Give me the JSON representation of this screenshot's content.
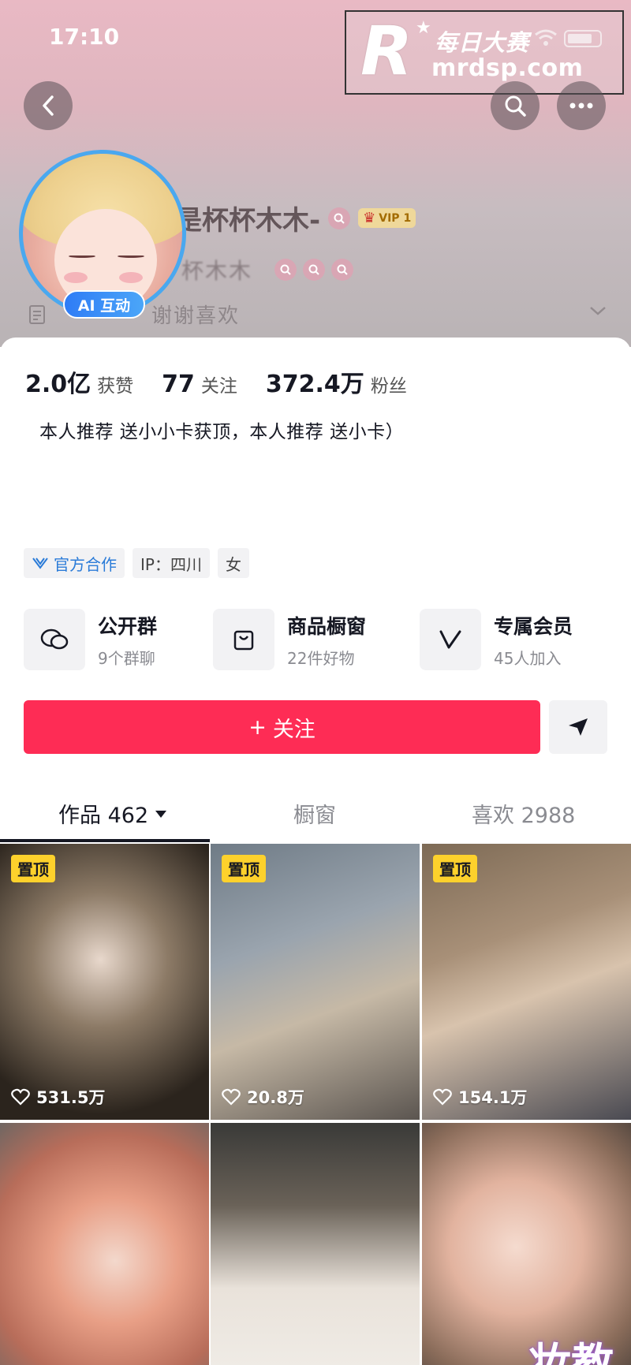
{
  "status_bar": {
    "time": "17:10"
  },
  "watermark": {
    "logo_letter": "R",
    "brand_cn": "每日大赛",
    "domain": "mrdsp.com"
  },
  "header": {
    "display_name": "是杯杯木木-",
    "vip_label": "VIP 1",
    "account_id": "杯木木",
    "signature": "谢谢喜欢"
  },
  "avatar": {
    "badge": "AI 互动"
  },
  "stats": [
    {
      "value": "2.0亿",
      "label": "获赞"
    },
    {
      "value": "77",
      "label": "关注"
    },
    {
      "value": "372.4万",
      "label": "粉丝"
    }
  ],
  "bio": "本人推荐 送小小卡获顶，本人推荐 送小卡）",
  "tags": [
    {
      "label": "官方合作",
      "icon": "official-cooperation-icon"
    },
    {
      "label": "IP：四川"
    },
    {
      "label": "女"
    }
  ],
  "features": [
    {
      "title": "公开群",
      "subtitle": "9个群聊",
      "icon": "group-chat-icon"
    },
    {
      "title": "商品橱窗",
      "subtitle": "22件好物",
      "icon": "shopping-bag-icon"
    },
    {
      "title": "专属会员",
      "subtitle": "45人加入",
      "icon": "vip-v-icon"
    }
  ],
  "actions": {
    "follow_label": "关注",
    "follow_prefix": "+"
  },
  "tabs": [
    {
      "label": "作品 462",
      "active": true
    },
    {
      "label": "橱窗",
      "active": false
    },
    {
      "label": "喜欢 2988",
      "active": false
    }
  ],
  "videos": [
    {
      "pinned": true,
      "pin_label": "置顶",
      "likes": "531.5万"
    },
    {
      "pinned": true,
      "pin_label": "置顶",
      "likes": "20.8万"
    },
    {
      "pinned": true,
      "pin_label": "置顶",
      "likes": "154.1万"
    },
    {
      "pinned": false,
      "likes": ""
    },
    {
      "pinned": false,
      "likes": ""
    },
    {
      "pinned": false,
      "likes": "",
      "overlay_text": "妆教"
    }
  ],
  "colors": {
    "primary": "#fe2c55",
    "ai_badge": "#2f7cf6",
    "pin": "#fdd12c",
    "official": "#2a7bd8"
  }
}
